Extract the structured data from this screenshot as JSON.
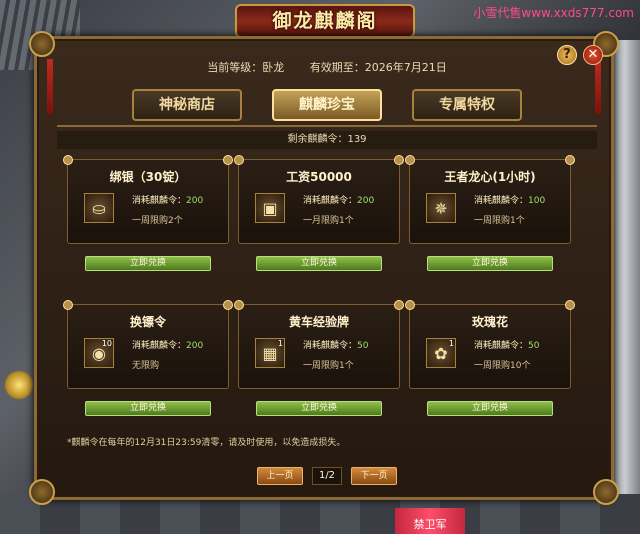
{
  "watermark": "小雪代售www.xxds777.com",
  "banner_title": "御龙麒麟阁",
  "info": {
    "level": "当前等级：卧龙",
    "expiry": "有效期至：2026年7月21日"
  },
  "tabs": [
    {
      "label": "神秘商店"
    },
    {
      "label": "麒麟珍宝"
    },
    {
      "label": "专属特权"
    }
  ],
  "active_tab": 1,
  "remaining": "剩余麒麟令：139",
  "cost_label": "消耗麒麟令：",
  "items": [
    {
      "name": "绑银（30锭）",
      "cost": "200",
      "limit": "一周限购2个",
      "icon": "silver-ingot-icon",
      "glyph": "⛀",
      "badge": ""
    },
    {
      "name": "工资50000",
      "cost": "200",
      "limit": "一月限购1个",
      "icon": "gold-chest-icon",
      "glyph": "▣",
      "badge": ""
    },
    {
      "name": "王者龙心(1小时)",
      "cost": "100",
      "limit": "一周限购1个",
      "icon": "dragon-heart-icon",
      "glyph": "✵",
      "badge": ""
    },
    {
      "name": "换镖令",
      "cost": "200",
      "limit": "无限购",
      "icon": "escort-token-icon",
      "glyph": "◉",
      "badge": "10"
    },
    {
      "name": "黄车经验牌",
      "cost": "50",
      "limit": "一周限购1个",
      "icon": "exp-card-icon",
      "glyph": "▦",
      "badge": "1"
    },
    {
      "name": "玫瑰花",
      "cost": "50",
      "limit": "一周限购10个",
      "icon": "rose-icon",
      "glyph": "✿",
      "badge": "1"
    }
  ],
  "redeem_label": "立即兑换",
  "note": "*麒麟令在每年的12月31日23:59清零，请及时使用，以免造成损失。",
  "pager": {
    "prev": "上一页",
    "page": "1/2",
    "next": "下一页"
  },
  "help": "?",
  "close": "✕",
  "scene_label": "禁卫军"
}
